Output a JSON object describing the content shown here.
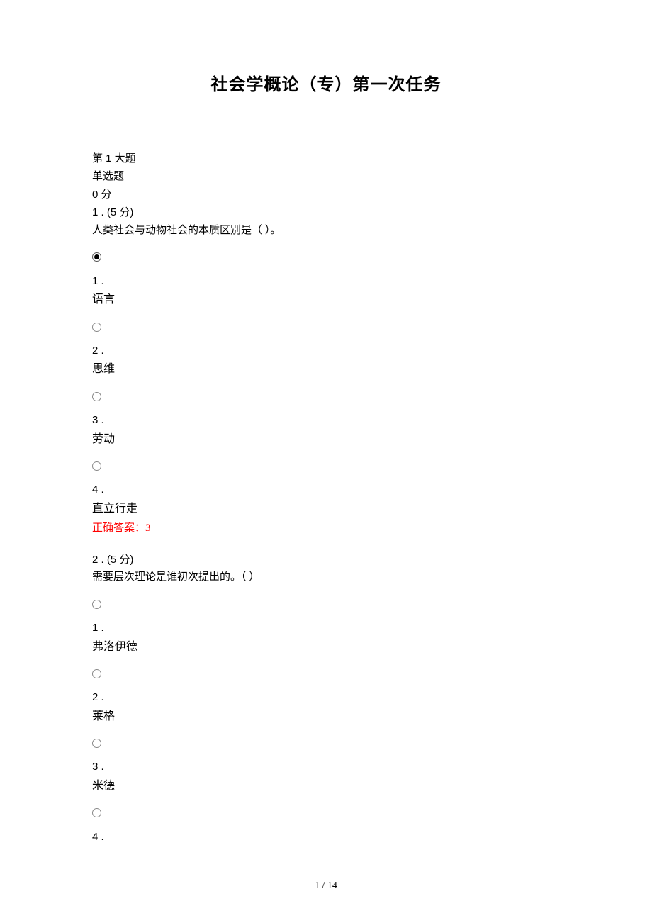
{
  "title": "社会学概论（专）第一次任务",
  "section": {
    "header": "第 1 大题",
    "type": "单选题",
    "score": "0 分"
  },
  "q1": {
    "num": "1 . (5 分)",
    "text": "人类社会与动物社会的本质区别是（ ）。",
    "opts": [
      {
        "n": "1 .",
        "t": "语言",
        "selected": true
      },
      {
        "n": "2 .",
        "t": "思维",
        "selected": false
      },
      {
        "n": "3 .",
        "t": "劳动",
        "selected": false
      },
      {
        "n": "4 .",
        "t": "直立行走",
        "selected": false
      }
    ],
    "answer": "正确答案：3"
  },
  "q2": {
    "num": "2 . (5 分)",
    "text": "需要层次理论是谁初次提出的。（ ）",
    "opts": [
      {
        "n": "1 .",
        "t": "弗洛伊德",
        "selected": false
      },
      {
        "n": "2 .",
        "t": "莱格",
        "selected": false
      },
      {
        "n": "3 .",
        "t": "米德",
        "selected": false
      },
      {
        "n": "4 .",
        "t": "",
        "selected": false
      }
    ]
  },
  "page": "1 / 14"
}
